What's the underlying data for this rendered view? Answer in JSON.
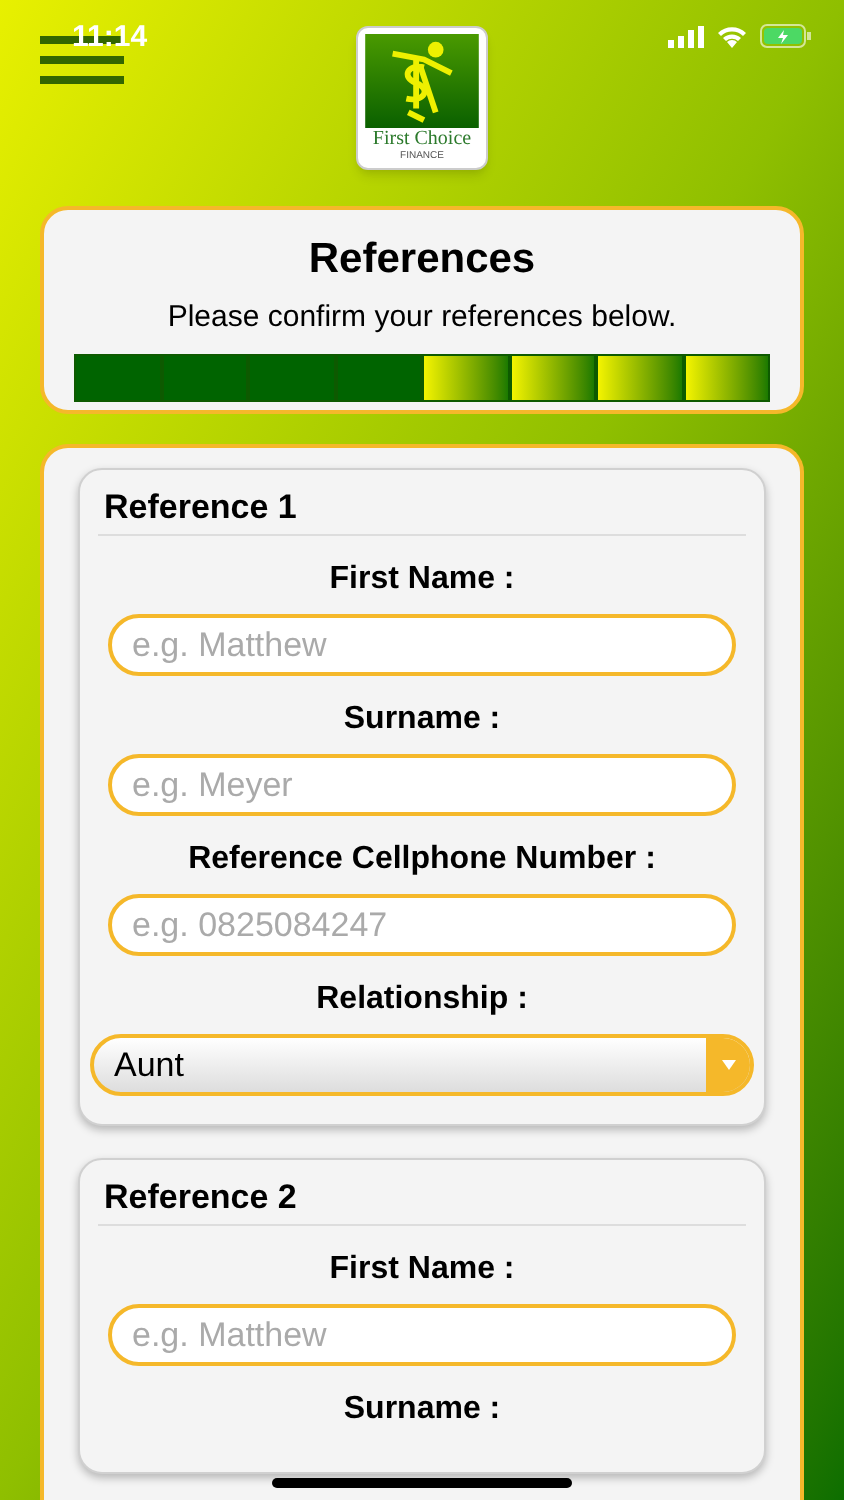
{
  "status_bar": {
    "time": "11:14"
  },
  "logo": {
    "name": "First Choice",
    "tagline": "FINANCE"
  },
  "header": {
    "title": "References",
    "subtitle": "Please confirm your references below.",
    "steps": [
      {
        "done": true
      },
      {
        "done": true
      },
      {
        "done": true
      },
      {
        "done": true
      },
      {
        "done": false
      },
      {
        "done": false
      },
      {
        "done": false
      },
      {
        "done": false
      }
    ]
  },
  "references": [
    {
      "title": "Reference 1",
      "fields": [
        {
          "kind": "text",
          "label": "First Name :",
          "placeholder": "e.g. Matthew"
        },
        {
          "kind": "text",
          "label": "Surname :",
          "placeholder": "e.g. Meyer"
        },
        {
          "kind": "text",
          "label": "Reference Cellphone Number :",
          "placeholder": "e.g. 0825084247"
        },
        {
          "kind": "select",
          "label": "Relationship :",
          "value": "Aunt"
        }
      ]
    },
    {
      "title": "Reference 2",
      "fields": [
        {
          "kind": "text",
          "label": "First Name :",
          "placeholder": "e.g. Matthew"
        },
        {
          "kind": "label",
          "label": "Surname :"
        }
      ]
    }
  ]
}
